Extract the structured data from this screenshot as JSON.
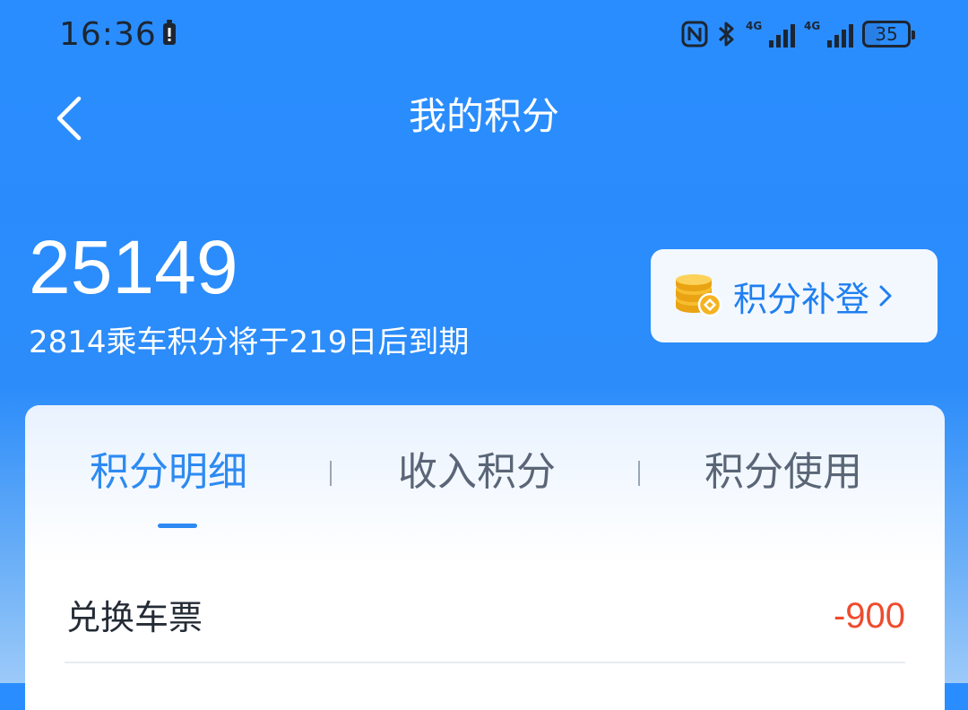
{
  "status_bar": {
    "time": "16:36",
    "network_label_1": "4G",
    "network_label_2": "4G",
    "battery_level": "35"
  },
  "nav": {
    "title": "我的积分"
  },
  "summary": {
    "total_points": "25149",
    "expiry_note": "2814乘车积分将于219日后到期",
    "makeup_button_label": "积分补登"
  },
  "tabs": [
    {
      "label": "积分明细",
      "active": true
    },
    {
      "label": "收入积分",
      "active": false
    },
    {
      "label": "积分使用",
      "active": false
    }
  ],
  "records": [
    {
      "title": "兑换车票",
      "amount": "-900"
    }
  ],
  "colors": {
    "header_blue": "#2a8dff",
    "accent_blue": "#2d8af2",
    "negative_red": "#ee4b2e",
    "coin_gold": "#f5b321"
  },
  "icons": {
    "back": "chevron-left-icon",
    "nfc": "nfc-icon",
    "bluetooth": "bluetooth-icon",
    "coin": "coin-stack-icon",
    "forward": "chevron-right-icon"
  }
}
